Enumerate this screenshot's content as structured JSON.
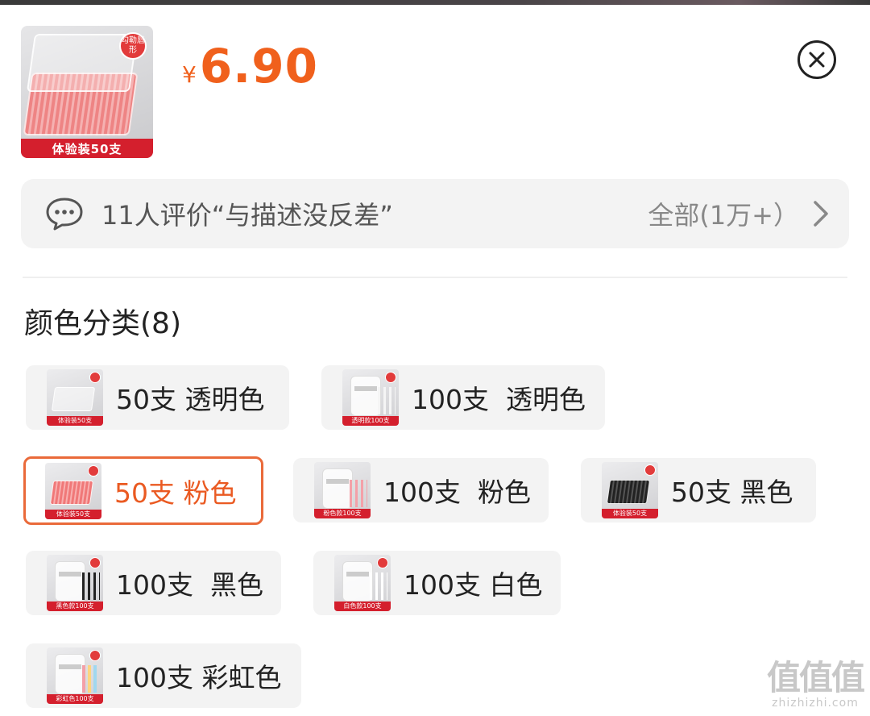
{
  "product": {
    "thumb_ribbon": "体验装50支",
    "thumb_seal": "勾勒唇形",
    "price_currency": "¥",
    "price_value": "6.90"
  },
  "review": {
    "text": "11人评价“与描述没反差”",
    "all_label": "全部(1万+）"
  },
  "variants": {
    "title": "颜色分类(8)",
    "items": [
      {
        "label": "50支 透明色",
        "thumb_tag": "体验装50支",
        "selected": false
      },
      {
        "label": "100支  透明色",
        "thumb_tag": "透明款100支",
        "selected": false
      },
      {
        "label": "50支 粉色",
        "thumb_tag": "体验装50支",
        "selected": true
      },
      {
        "label": "100支  粉色",
        "thumb_tag": "粉色款100支",
        "selected": false
      },
      {
        "label": "50支 黑色",
        "thumb_tag": "体验装50支",
        "selected": false
      },
      {
        "label": "100支  黑色",
        "thumb_tag": "黑色款100支",
        "selected": false
      },
      {
        "label": "100支 白色",
        "thumb_tag": "白色款100支",
        "selected": false
      },
      {
        "label": "100支 彩虹色",
        "thumb_tag": "彩虹色100支",
        "selected": false
      }
    ]
  },
  "watermark": {
    "big": "值值值",
    "small": "zhizhizhi.com"
  },
  "colors": {
    "price": "#f0601c",
    "selected_border": "#ea6a3a",
    "ribbon": "#d41f2d",
    "chip_bg": "#f3f3f3"
  },
  "icons": {
    "close": "close-circle-icon",
    "review": "chat-bubble-icon",
    "chevron": "chevron-right-icon"
  }
}
